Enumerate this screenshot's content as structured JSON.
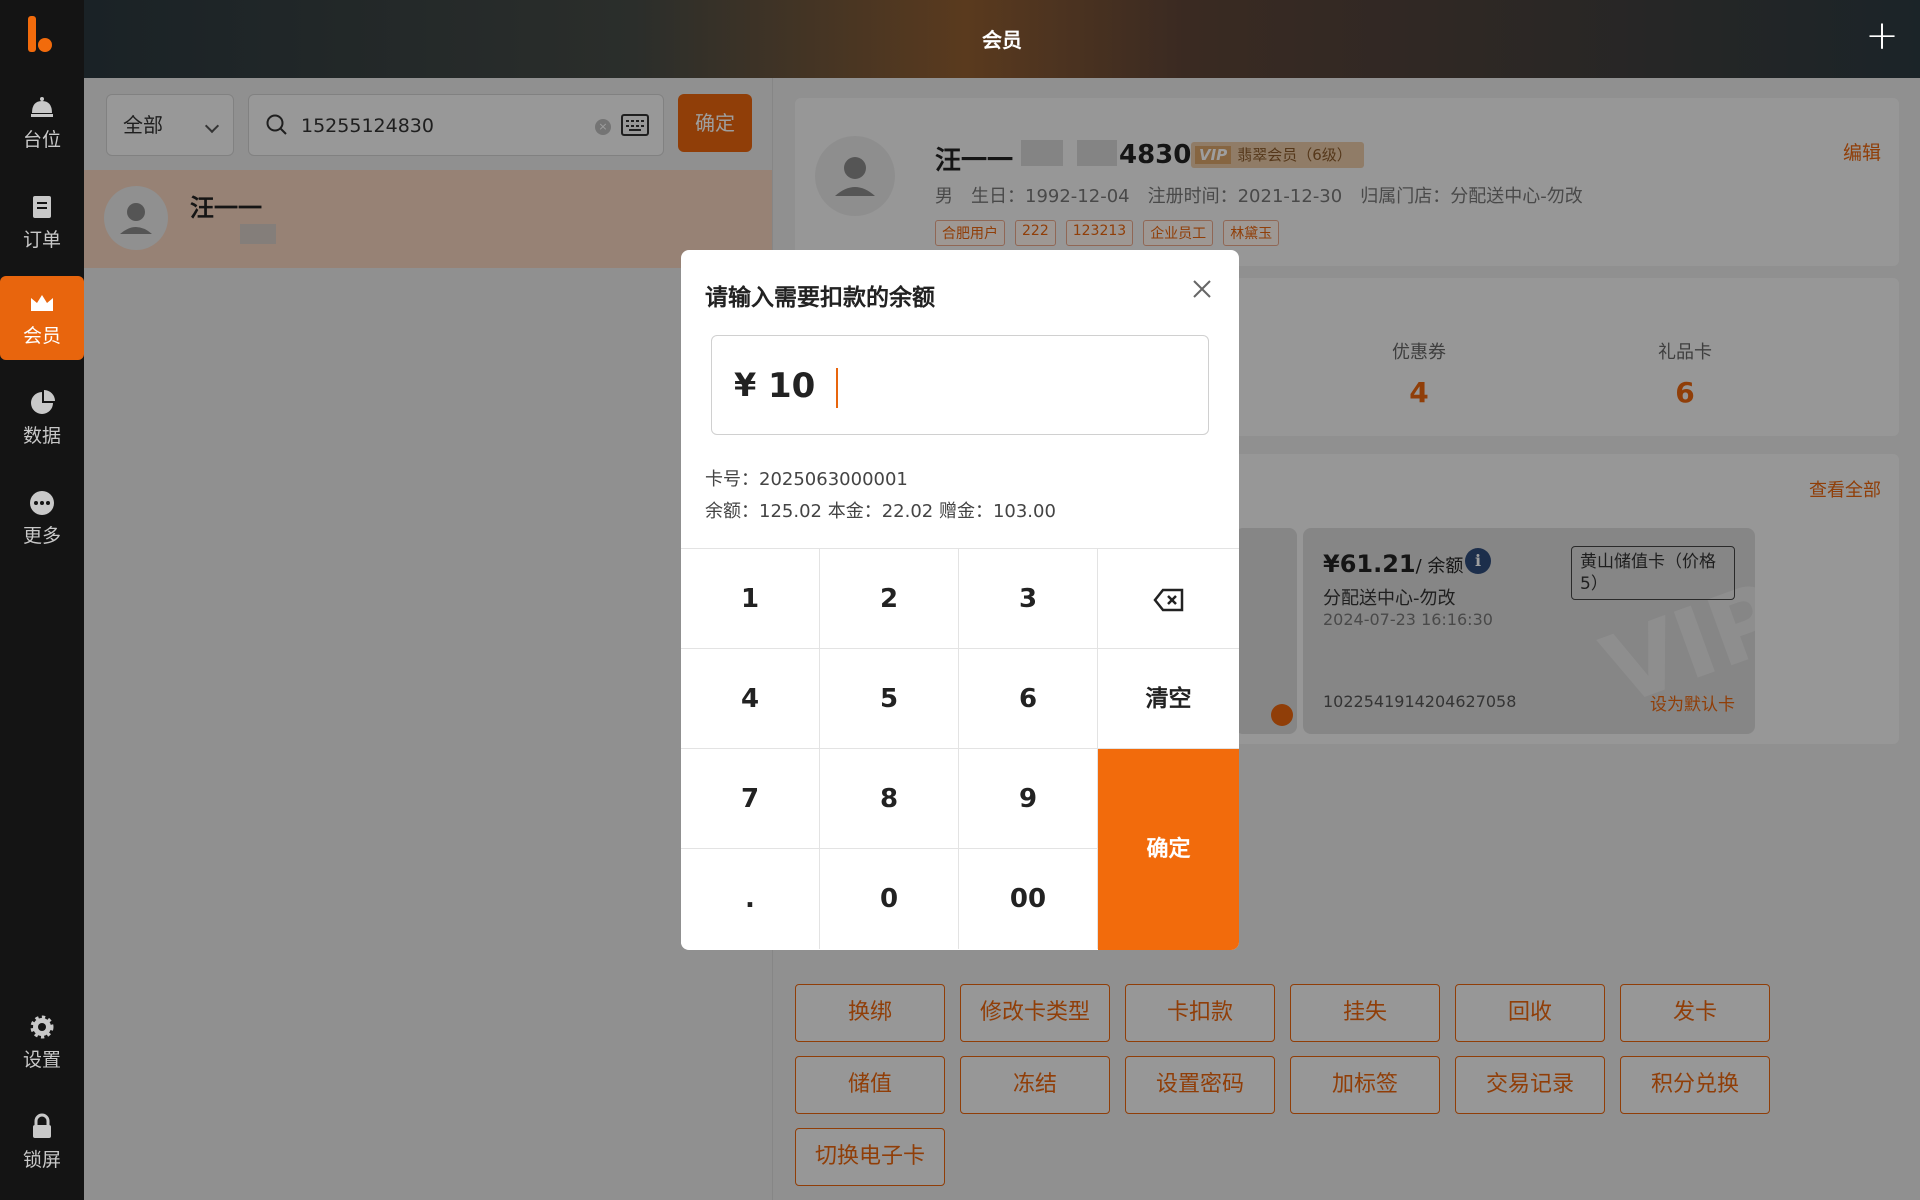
{
  "app": {
    "page_title": "会员"
  },
  "sidebar": {
    "items": [
      {
        "label": "台位",
        "icon": "bell-icon"
      },
      {
        "label": "订单",
        "icon": "clipboard-icon"
      },
      {
        "label": "会员",
        "icon": "crown-icon",
        "active": true
      },
      {
        "label": "数据",
        "icon": "pie-chart-icon"
      },
      {
        "label": "更多",
        "icon": "more-icon"
      },
      {
        "label": "设置",
        "icon": "gear-icon"
      },
      {
        "label": "锁屏",
        "icon": "lock-icon"
      }
    ]
  },
  "search": {
    "filter": "全部",
    "query": "15255124830",
    "confirm_label": "确定"
  },
  "result": {
    "name": "汪一一"
  },
  "member": {
    "name": "汪一一",
    "phone_suffix": "4830",
    "vip_label": "VIP",
    "level": "翡翠会员（6级）",
    "edit_label": "编辑",
    "gender": "男",
    "birthday": "生日：1992-12-04",
    "registered": "注册时间：2021-12-30",
    "store": "归属门店：分配送中心-勿改",
    "tags": [
      "合肥用户",
      "222",
      "123213",
      "企业员工",
      "林黛玉"
    ]
  },
  "assets": {
    "coupons": {
      "label": "优惠券",
      "value": "4"
    },
    "gift_cards": {
      "label": "礼品卡",
      "value": "6"
    }
  },
  "cards": {
    "view_all": "查看全部",
    "card": {
      "amount": "¥61.21",
      "amount_suffix": "/ 余额",
      "store": "分配送中心-勿改",
      "date": "2024-07-23 16:16:30",
      "type": "黄山储值卡（价格5）",
      "number": "1022541914204627058",
      "set_default": "设为默认卡"
    }
  },
  "actions": {
    "row1": [
      "换绑",
      "修改卡类型",
      "卡扣款",
      "挂失",
      "回收",
      "发卡"
    ],
    "row2": [
      "储值",
      "冻结",
      "设置密码",
      "加标签",
      "交易记录",
      "积分兑换"
    ],
    "row3": [
      "切换电子卡"
    ]
  },
  "modal": {
    "title": "请输入需要扣款的余额",
    "currency": "¥",
    "amount": "10",
    "card_no": "卡号：2025063000001",
    "balance_line": "余额：125.02  本金：22.02  赠金：103.00",
    "keys": {
      "k1": "1",
      "k2": "2",
      "k3": "3",
      "k4": "4",
      "k5": "5",
      "k6": "6",
      "k7": "7",
      "k8": "8",
      "k9": "9",
      "kdot": ".",
      "k0": "0",
      "k00": "00",
      "clear": "清空",
      "enter": "确定"
    }
  }
}
